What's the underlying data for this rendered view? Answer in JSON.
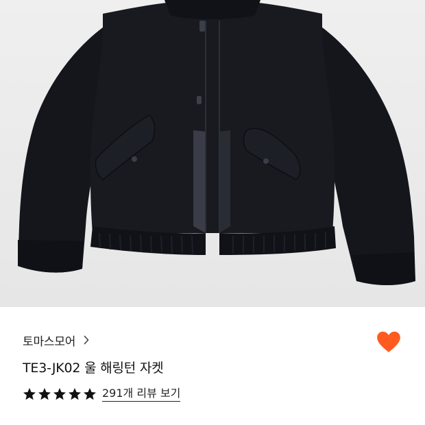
{
  "product_image": {
    "icon": "product-photo",
    "description_colors": {
      "background": "#ececec",
      "garment": "#12141a"
    }
  },
  "brand": {
    "name": "토마스모어",
    "chevron_icon": "chevron-right-icon"
  },
  "like": {
    "icon": "heart-icon",
    "color": "#ff5a1f",
    "liked": true
  },
  "product": {
    "title": "TE3-JK02 울 해링턴 자켓"
  },
  "rating": {
    "stars": 5,
    "max_stars": 5,
    "star_icon": "star-icon",
    "review_link": "291개 리뷰 보기"
  }
}
